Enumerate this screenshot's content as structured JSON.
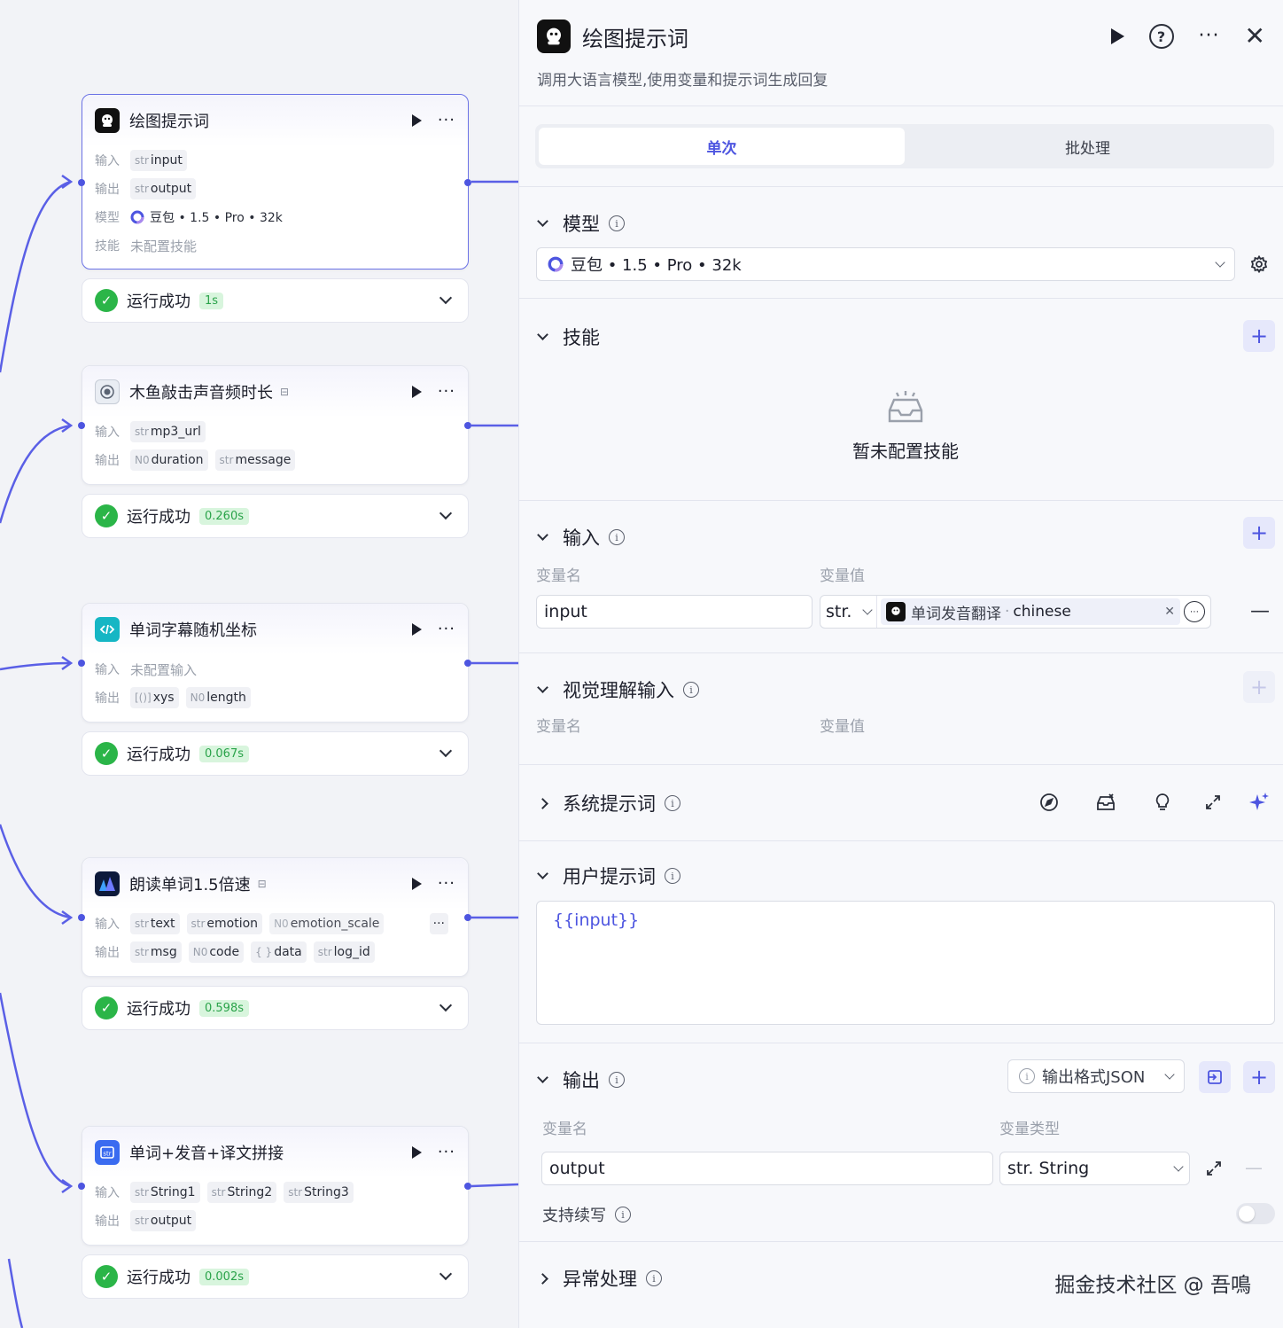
{
  "nodes": [
    {
      "title": "绘图提示词",
      "rows": [
        {
          "label": "输入",
          "tags": [
            {
              "type": "str",
              "name": "input"
            }
          ]
        },
        {
          "label": "输出",
          "tags": [
            {
              "type": "str",
              "name": "output"
            }
          ]
        },
        {
          "label": "模型",
          "text": "豆包 • 1.5 • Pro • 32k"
        },
        {
          "label": "技能",
          "muted": "未配置技能"
        }
      ],
      "status": "运行成功",
      "time": "1s"
    },
    {
      "title": "木鱼敲击声音频时长",
      "rows": [
        {
          "label": "输入",
          "tags": [
            {
              "type": "str",
              "name": "mp3_url"
            }
          ]
        },
        {
          "label": "输出",
          "tags": [
            {
              "type": "N0",
              "name": "duration"
            },
            {
              "type": "str",
              "name": "message"
            }
          ]
        }
      ],
      "status": "运行成功",
      "time": "0.260s"
    },
    {
      "title": "单词字幕随机坐标",
      "rows": [
        {
          "label": "输入",
          "muted": "未配置输入"
        },
        {
          "label": "输出",
          "tags": [
            {
              "type": "[()]",
              "name": "xys"
            },
            {
              "type": "N0",
              "name": "length"
            }
          ]
        }
      ],
      "status": "运行成功",
      "time": "0.067s"
    },
    {
      "title": "朗读单词1.5倍速",
      "rows": [
        {
          "label": "输入",
          "tags": [
            {
              "type": "str",
              "name": "text"
            },
            {
              "type": "str",
              "name": "emotion"
            },
            {
              "type": "N0",
              "name": "emotion_scale"
            }
          ],
          "more": "···"
        },
        {
          "label": "输出",
          "tags": [
            {
              "type": "str",
              "name": "msg"
            },
            {
              "type": "N0",
              "name": "code"
            },
            {
              "type": "{ }",
              "name": "data"
            },
            {
              "type": "str",
              "name": "log_id"
            }
          ]
        }
      ],
      "status": "运行成功",
      "time": "0.598s"
    },
    {
      "title": "单词+发音+译文拼接",
      "rows": [
        {
          "label": "输入",
          "tags": [
            {
              "type": "str",
              "name": "String1"
            },
            {
              "type": "str",
              "name": "String2"
            },
            {
              "type": "str",
              "name": "String3"
            }
          ]
        },
        {
          "label": "输出",
          "tags": [
            {
              "type": "str",
              "name": "output"
            }
          ]
        }
      ],
      "status": "运行成功",
      "time": "0.002s"
    }
  ],
  "panel": {
    "title": "绘图提示词",
    "description": "调用大语言模型,使用变量和提示词生成回复",
    "tabs": [
      "单次",
      "批处理"
    ],
    "model_section": {
      "title": "模型",
      "model": "豆包 • 1.5 • Pro • 32k"
    },
    "skills_section": {
      "title": "技能",
      "empty": "暂未配置技能"
    },
    "input_section": {
      "title": "输入",
      "col_name": "变量名",
      "col_value": "变量值",
      "var_name": "input",
      "var_type": "str.",
      "ref_node": "单词发音翻译",
      "ref_var": "chinese"
    },
    "vision_section": {
      "title": "视觉理解输入",
      "col_name": "变量名",
      "col_value": "变量值"
    },
    "system_prompt": {
      "title": "系统提示词"
    },
    "user_prompt": {
      "title": "用户提示词",
      "content": "{{input}}"
    },
    "output_section": {
      "title": "输出",
      "format_button": "输出格式JSON",
      "col_name": "变量名",
      "col_type": "变量类型",
      "var_name": "output",
      "var_type": "str. String",
      "continue_label": "支持续写"
    },
    "error_section": {
      "title": "异常处理"
    },
    "watermark": "掘金技术社区 @ 吾鳴"
  },
  "colors": {
    "accent": "#4d55e0",
    "success": "#2bb548",
    "success_bg": "#d8f5dd"
  }
}
